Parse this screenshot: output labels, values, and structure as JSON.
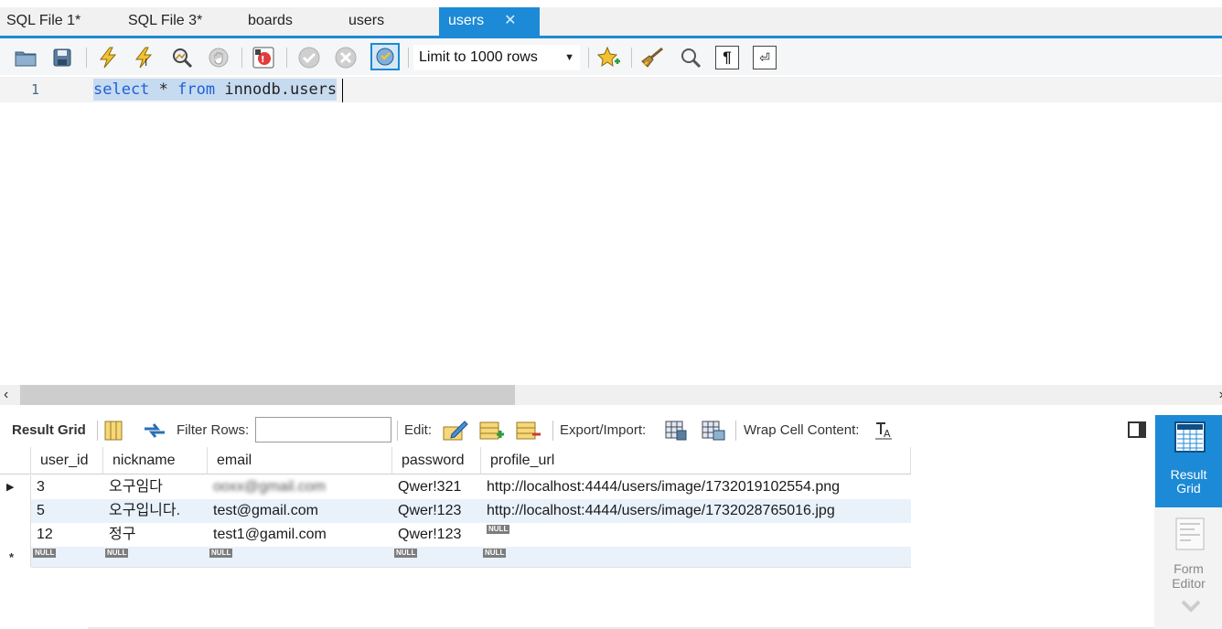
{
  "tabs": [
    {
      "label": "SQL File 1*",
      "active": false
    },
    {
      "label": "SQL File 3*",
      "active": false
    },
    {
      "label": "boards",
      "active": false
    },
    {
      "label": "users",
      "active": false
    },
    {
      "label": "users",
      "active": true
    }
  ],
  "tab_close_glyph": "✕",
  "toolbar": {
    "icons": [
      "open-folder-icon",
      "save-icon",
      "execute-lightning-icon",
      "execute-current-lightning-icon",
      "explain-magnifier-icon",
      "stop-icon",
      "toggle-error-icon",
      "commit-check-icon",
      "rollback-x-icon",
      "autocommit-toggle-icon",
      "beautify-star-icon",
      "brush-icon",
      "find-magnifier-icon",
      "invisible-chars-pilcrow-icon",
      "wrap-lines-icon"
    ],
    "limit_label": "Limit to 1000 rows",
    "pilcrow": "¶",
    "wrap_glyph": "⏎"
  },
  "editor": {
    "line_number": "1",
    "code_kw1": "select",
    "code_mid": " * ",
    "code_kw2": "from",
    "code_rest": " innodb.users"
  },
  "results_toolbar": {
    "result_grid_label": "Result Grid",
    "filter_rows_label": "Filter Rows:",
    "filter_value": "",
    "edit_label": "Edit:",
    "export_import_label": "Export/Import:",
    "wrap_cell_label": "Wrap Cell Content:"
  },
  "grid": {
    "columns": [
      "user_id",
      "nickname",
      "email",
      "password",
      "profile_url"
    ],
    "rows": [
      {
        "user_id": "3",
        "nickname": "오구임다",
        "email": "ooxx@gmail.com",
        "password": "Qwer!321",
        "profile_url": "http://localhost:4444/users/image/1732019102554.png",
        "selected": true
      },
      {
        "user_id": "5",
        "nickname": "오구입니다.",
        "email": "test@gmail.com",
        "password": "Qwer!123",
        "profile_url": "http://localhost:4444/users/image/1732028765016.jpg",
        "selected": false
      },
      {
        "user_id": "12",
        "nickname": "정구",
        "email": "test1@gamil.com",
        "password": "Qwer!123",
        "profile_url": null,
        "selected": false
      }
    ],
    "null_label": "NULL",
    "new_row_marker": "*"
  },
  "side_panel": {
    "result_grid_line1": "Result",
    "result_grid_line2": "Grid",
    "form_editor_line1": "Form",
    "form_editor_line2": "Editor"
  },
  "colors": {
    "accent": "#1c8ad6",
    "row_alt": "#e9f1fb",
    "selection": "#c7dbf0"
  }
}
